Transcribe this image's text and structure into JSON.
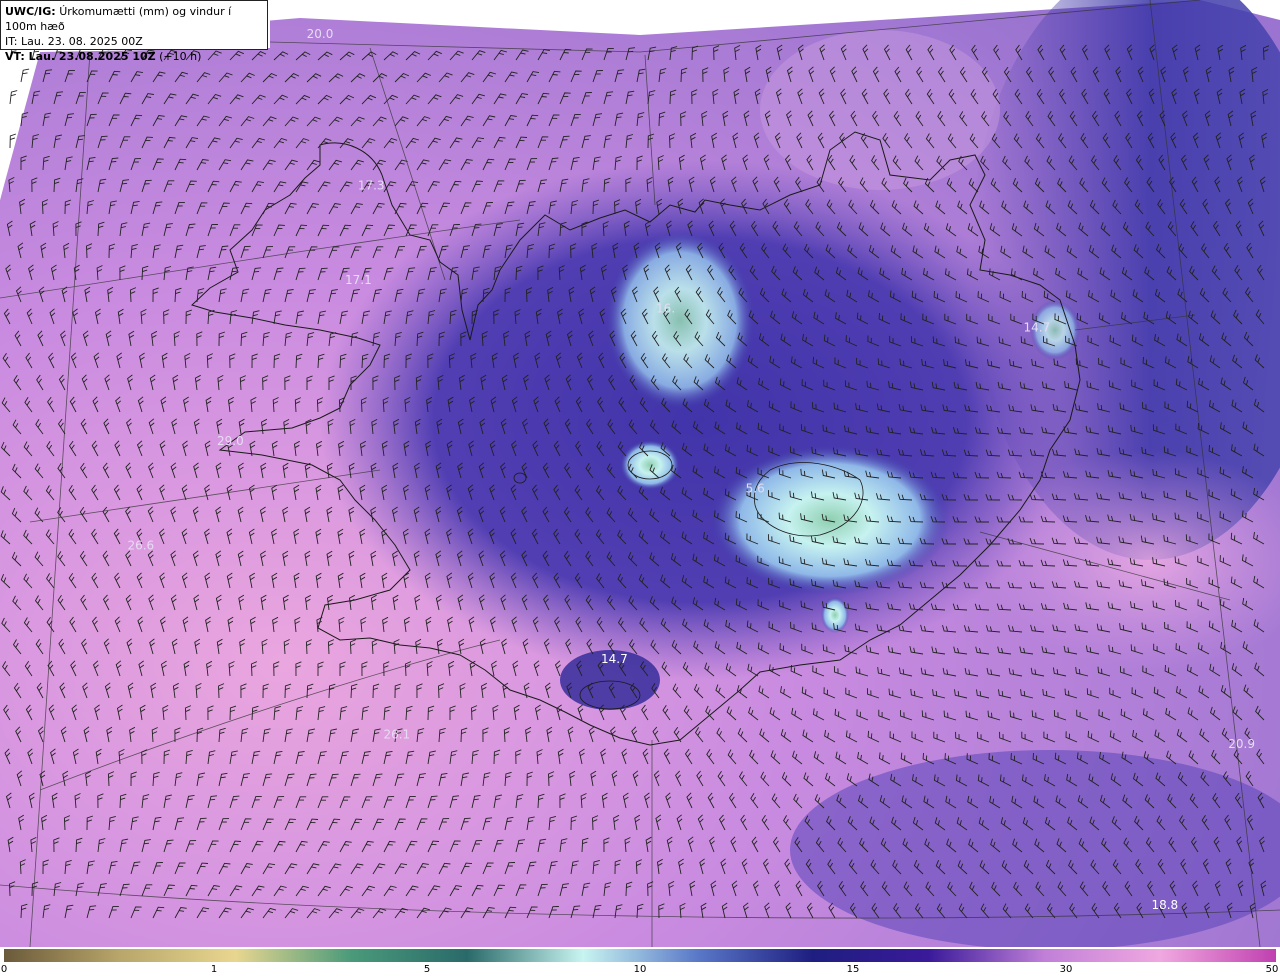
{
  "header": {
    "model": "UWC/IG:",
    "title": "Úrkomumætti (mm) og vindur í 100m hæð",
    "it_line": "IT: Lau. 23. 08. 2025 00Z",
    "vt_line": "VT: Lau. 23.08.2025 10Z",
    "lead": "(+10 h)"
  },
  "map": {
    "labels": [
      {
        "text": "20.0",
        "col": 25,
        "row": 4,
        "tone": "light"
      },
      {
        "text": "17.3",
        "col": 29,
        "row": 20,
        "tone": "light"
      },
      {
        "text": "17.1",
        "col": 28,
        "row": 30,
        "tone": "light"
      },
      {
        "text": "16.",
        "col": 52,
        "row": 33,
        "tone": "light"
      },
      {
        "text": "14.7",
        "col": 81,
        "row": 35,
        "tone": "light"
      },
      {
        "text": "29.0",
        "col": 18,
        "row": 47,
        "tone": "light"
      },
      {
        "text": "5.6",
        "col": 59,
        "row": 52,
        "tone": "light"
      },
      {
        "text": "26.6",
        "col": 11,
        "row": 58,
        "tone": "light"
      },
      {
        "text": "14.7",
        "col": 48,
        "row": 70,
        "tone": "white"
      },
      {
        "text": "26.1",
        "col": 31,
        "row": 78,
        "tone": "light"
      },
      {
        "text": "20.9",
        "col": 97,
        "row": 79,
        "tone": "light"
      },
      {
        "text": "18.8",
        "col": 91,
        "row": 96,
        "tone": "white"
      }
    ],
    "colors": {
      "ocean_pink": "#e7a3de",
      "ocean_purple": "#8b63c4",
      "deep_blue": "#2c2796",
      "ice_cyan": "#bff0f0",
      "core_green": "#7fbfa0",
      "land_line": "#1a1a1a",
      "barb": "#222222"
    }
  },
  "colorbar": {
    "ticks": [
      "0",
      "1",
      "5",
      "10",
      "15",
      "30",
      "50"
    ],
    "colors": [
      "#6b5a3a",
      "#b8a66a",
      "#e8d690",
      "#4a9a7a",
      "#2a6a6a",
      "#c8f4f0",
      "#5a78c8",
      "#1e1e80",
      "#3a1a9a",
      "#c080d8",
      "#f0a8e0",
      "#c040b0"
    ]
  }
}
